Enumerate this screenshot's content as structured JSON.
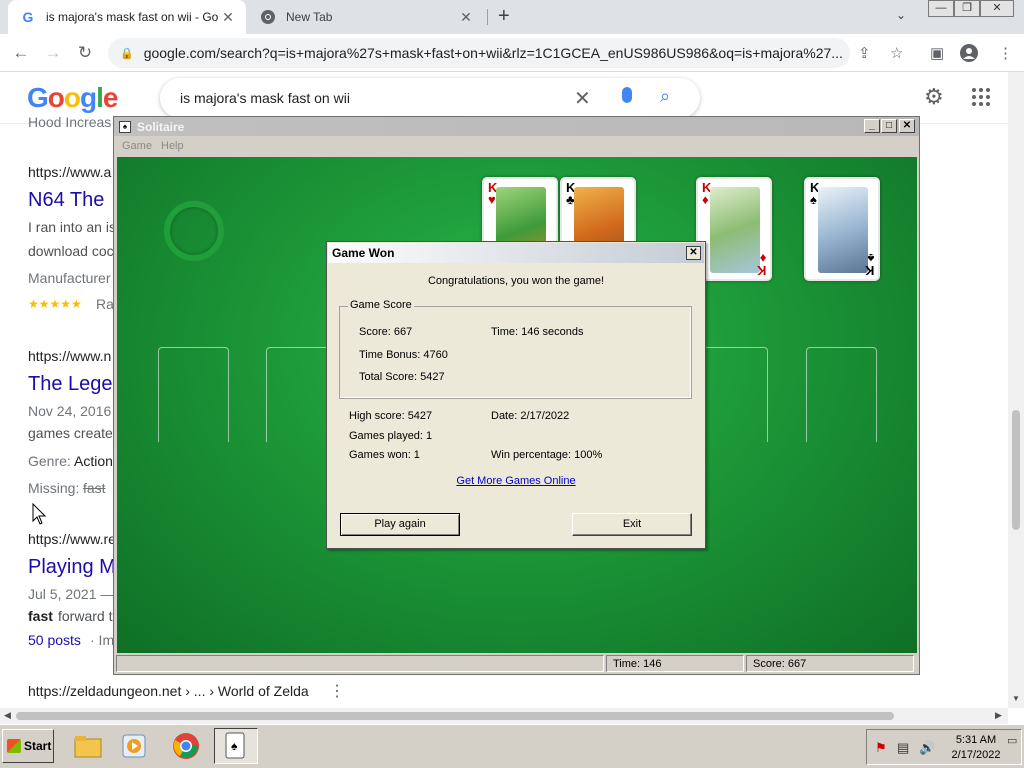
{
  "browser": {
    "tabs": [
      {
        "title": "is majora's mask fast on wii - Googl",
        "favicon": "G"
      },
      {
        "title": "New Tab",
        "favicon": "chrome-icon"
      }
    ],
    "new_tab": "+",
    "tab_close": "✕",
    "url": "google.com/search?q=is+majora%27s+mask+fast+on+wii&rlz=1C1GCEA_enUS986US986&oq=is+majora%27...",
    "window_controls": [
      "—",
      "❐",
      "✕"
    ]
  },
  "google": {
    "logo": "Google",
    "query": "is majora's mask fast on wii",
    "results": [
      {
        "cite": "https://www.a",
        "title": "N64 The",
        "snippet1": "I ran into an is",
        "snippet2": "download coc",
        "meta": "Manufacturer",
        "stars": "★★★★★",
        "rating": "Ra"
      },
      {
        "cite": "https://www.n",
        "title": "The Lege",
        "snippet1": "Nov 24, 2016",
        "snippet2": "games create",
        "meta_label": "Genre:",
        "meta_value": "Action",
        "missing_label": "Missing:",
        "missing_value": "fast"
      },
      {
        "cite": "https://www.re",
        "title": "Playing M",
        "snippet1": "Jul 5, 2021 —",
        "snippet2_bold": "fast",
        "snippet2": "forward t",
        "posts": "50 posts",
        "posts_rest": "· Im"
      }
    ],
    "bottom_result": "https://zeldadungeon.net › ... › World of Zelda",
    "top_cut_text": "Hood Increas"
  },
  "solitaire": {
    "title": "Solitaire",
    "menu": [
      "Game",
      "Help"
    ],
    "foundations": [
      {
        "rank": "K",
        "suit": "♥",
        "color": "#cc0000"
      },
      {
        "rank": "K",
        "suit": "♣",
        "color": "#000000"
      },
      {
        "rank": "K",
        "suit": "♦",
        "color": "#cc0000"
      },
      {
        "rank": "K",
        "suit": "♠",
        "color": "#000000"
      }
    ],
    "status": {
      "time": "Time:  146",
      "score": "Score: 667"
    }
  },
  "dialog": {
    "title": "Game Won",
    "message": "Congratulations, you won the game!",
    "group_label": "Game Score",
    "score": "Score: 667",
    "time": "Time:  146 seconds",
    "time_bonus": "Time Bonus: 4760",
    "total_score": "Total Score: 5427",
    "high_score": "High score: 5427",
    "date": "Date: 2/17/2022",
    "games_played": "Games played: 1",
    "games_won": "Games won: 1",
    "win_percentage": "Win percentage: 100%",
    "link": "Get More Games Online",
    "play_again": "Play again",
    "exit": "Exit"
  },
  "taskbar": {
    "start": "Start",
    "time": "5:31 AM",
    "date": "2/17/2022"
  }
}
